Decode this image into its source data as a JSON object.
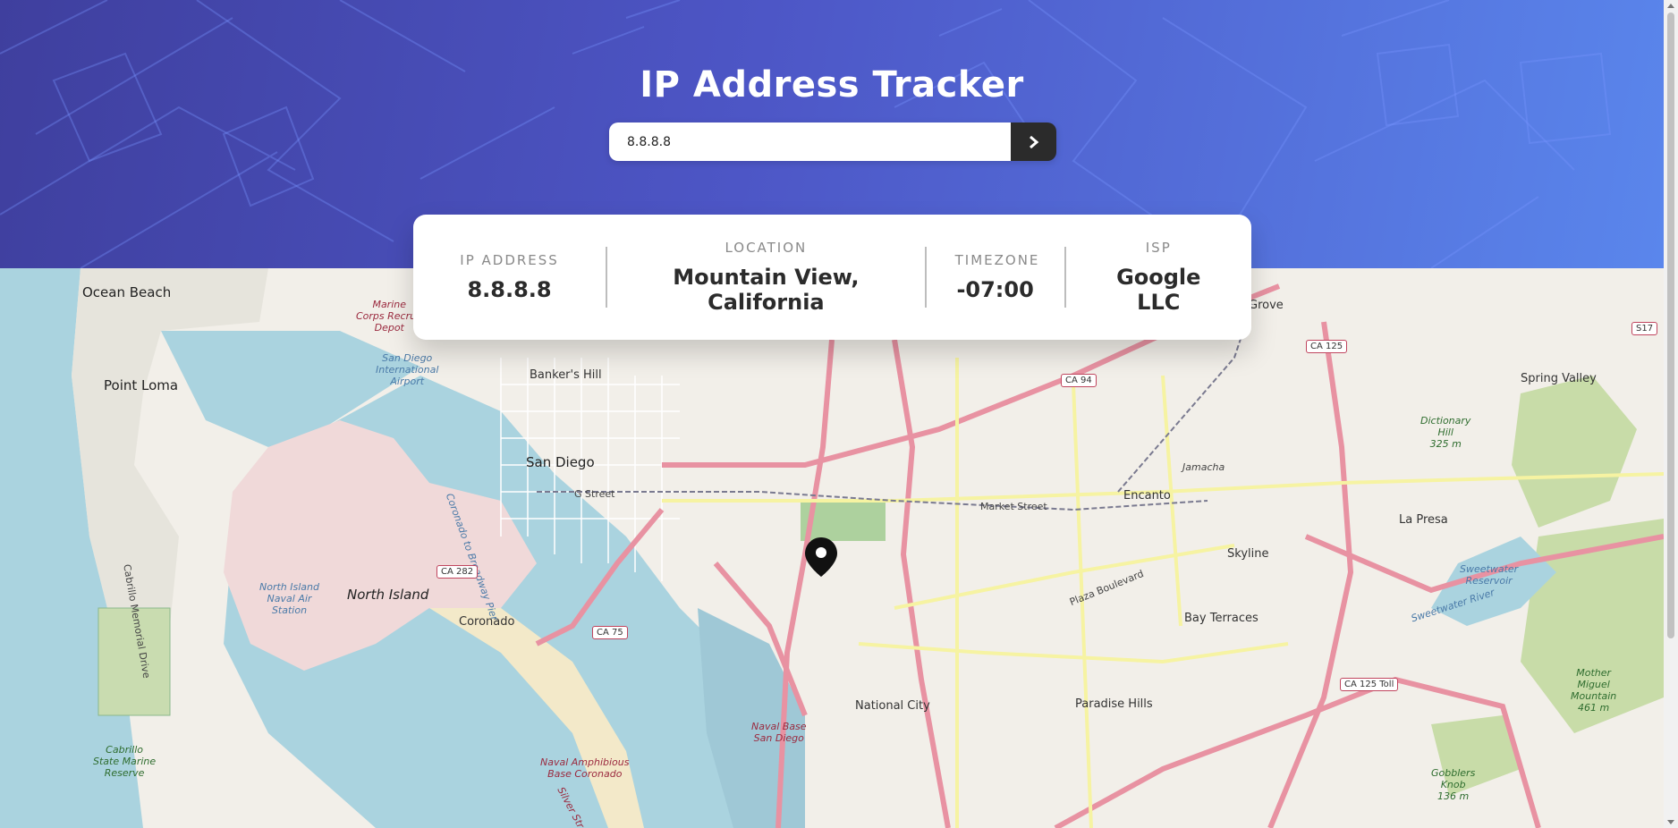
{
  "header": {
    "title": "IP Address Tracker",
    "search": {
      "value": "8.8.8.8",
      "placeholder": ""
    },
    "submit_icon": "chevron-right-icon"
  },
  "info": {
    "ip": {
      "label": "IP ADDRESS",
      "value": "8.8.8.8"
    },
    "location": {
      "label": "LOCATION",
      "value": "Mountain View, California"
    },
    "timezone": {
      "label": "TIMEZONE",
      "value": "-07:00"
    },
    "isp": {
      "label": "ISP",
      "value": "Google LLC"
    }
  },
  "map": {
    "marker_icon": "location-pin-icon",
    "places": {
      "ocean_beach": "Ocean Beach",
      "point_loma": "Point Loma",
      "marine_depot": "Marine\nCorps Recruit\nDepot",
      "airport": "San Diego\nInternational\nAirport",
      "bankers_hill": "Banker's Hill",
      "san_diego": "San Diego",
      "g_street": "G Street",
      "north_island": "North Island",
      "naval_air": "North Island\nNaval Air\nStation",
      "coronado": "Coronado",
      "coronado_broadway": "Coronado to Broadway Pier",
      "cabrillo_drive": "Cabrillo Memorial Drive",
      "cabrillo_reserve": "Cabrillo\nState Marine\nReserve",
      "naval_base": "Naval Base\nSan Diego",
      "naval_amphibious": "Naval Amphibious\nBase Coronado",
      "national_city": "National City",
      "paradise_hills": "Paradise Hills",
      "bay_terraces": "Bay Terraces",
      "skyline": "Skyline",
      "encanto": "Encanto",
      "la_presa": "La Presa",
      "spring_valley": "Spring Valley",
      "grove": "Grove",
      "jamacha": "Jamacha",
      "market_street": "Market Street",
      "plaza_boulevard": "Plaza Boulevard",
      "dictionary_hill": "Dictionary\nHill\n325 m",
      "sweetwater_reservoir": "Sweetwater\nReservoir",
      "sweetwater_river": "Sweetwater River",
      "mother_miguel": "Mother\nMiguel\nMountain\n461 m",
      "gobblers_knob": "Gobblers\nKnob\n136 m",
      "silver_strand": "Silver Strand Blvd"
    },
    "shields": {
      "ca94": "CA 94",
      "ca125": "CA 125",
      "ca282": "CA 282",
      "ca75": "CA 75",
      "ca125toll": "CA 125 Toll",
      "s17": "S17"
    }
  }
}
